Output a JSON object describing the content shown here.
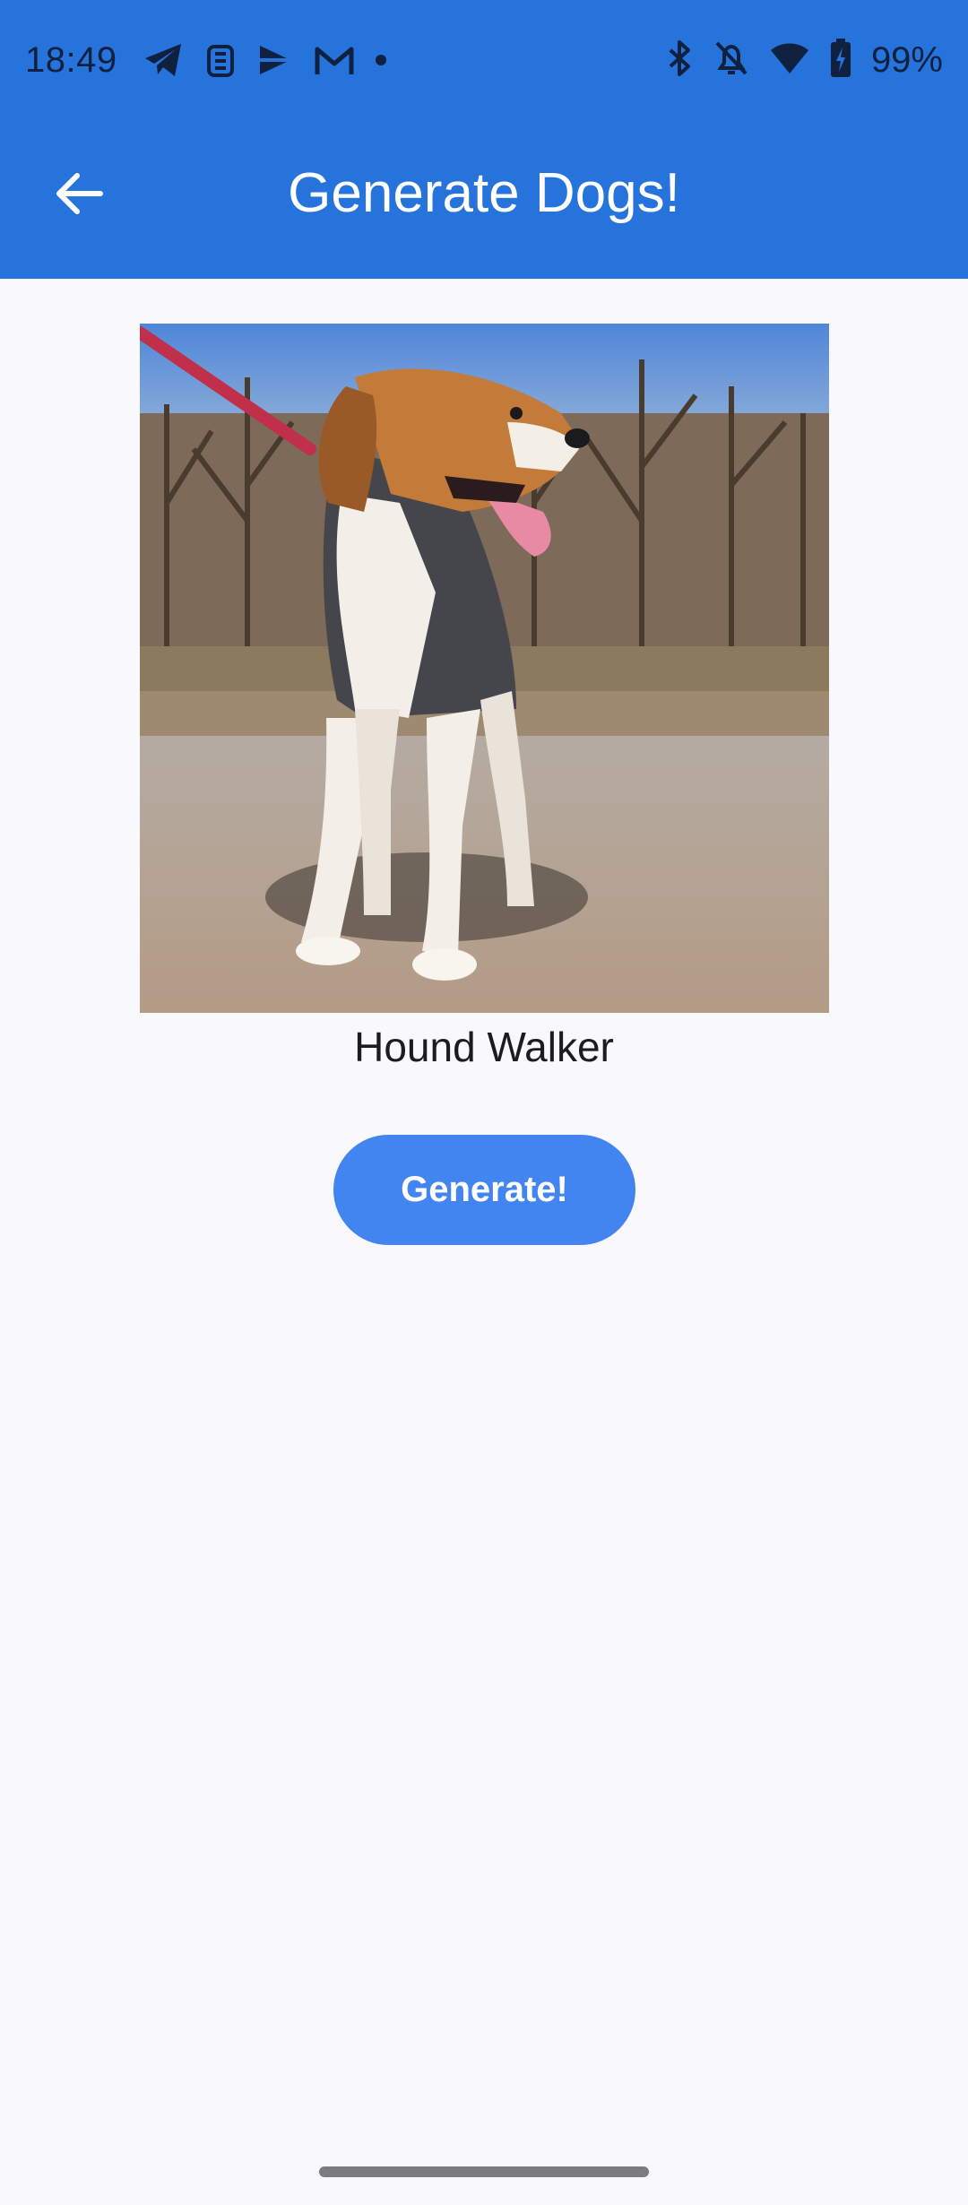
{
  "status_bar": {
    "time": "18:49",
    "battery_percent": "99%",
    "left_icons": [
      "telegram-icon",
      "teams-icon",
      "playstore-icon",
      "gmail-icon",
      "dot-icon"
    ],
    "right_icons": [
      "bluetooth-icon",
      "bell-off-icon",
      "wifi-icon",
      "battery-charging-icon"
    ]
  },
  "toolbar": {
    "title": "Generate Dogs!",
    "back_icon": "arrow-back-icon"
  },
  "content": {
    "breed_name": "Hound Walker",
    "generate_label": "Generate!"
  },
  "colors": {
    "app_bar": "#2673dc",
    "background": "#f9f8fd",
    "button": "#4285f0",
    "status_icons": "#10203f"
  }
}
